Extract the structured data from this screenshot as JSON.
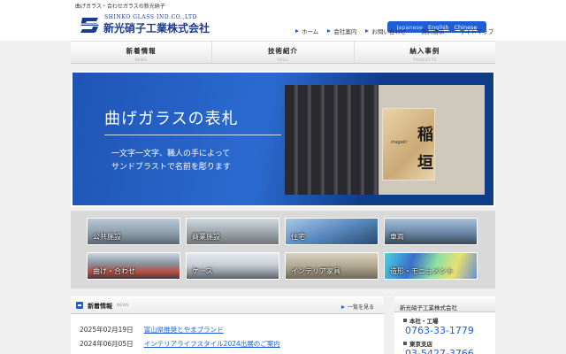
{
  "page": {
    "tagline": "曲げガラス・合わせガラスの新光硝子"
  },
  "header": {
    "logo_en": "SHINKO GLASS IND.CO.,LTD",
    "logo_jp": "新光硝子工業株式会社",
    "languages": [
      "Japanese",
      "English",
      "Chinese"
    ],
    "selected_language": "Japanese",
    "util_nav": [
      "ホーム",
      "会社案内",
      "お問い合わせ",
      "資料請求",
      "サイトマップ"
    ],
    "accent_color": "#1e5fd6"
  },
  "global_nav": [
    {
      "label": "新着情報",
      "sub": "NEWS"
    },
    {
      "label": "技術紹介",
      "sub": "SKILL"
    },
    {
      "label": "納入事例",
      "sub": "PRODUCTS"
    }
  ],
  "hero": {
    "title": "曲げガラスの表札",
    "line1": "一文字一文字、職人の手によって",
    "line2": "サンドブラストで名前を彫ります",
    "plate_char1": "稲",
    "plate_char2": "垣",
    "plate_romaji": "inagaki"
  },
  "categories": [
    {
      "label": "公共施設"
    },
    {
      "label": "商業施設"
    },
    {
      "label": "住宅"
    },
    {
      "label": "車両"
    },
    {
      "label": "曲げ・合わせ"
    },
    {
      "label": "ケース"
    },
    {
      "label": "インテリア家具"
    },
    {
      "label": "造形・モニュメント"
    }
  ],
  "news": {
    "title": "新着情報",
    "title_en": "NEWS",
    "more_label": "一覧を見る",
    "items": [
      {
        "date": "2025年02月19日",
        "title": "富山県推奨とやまブランド"
      },
      {
        "date": "2024年06月05日",
        "title": "インテリアライフスタイル2024出展のご案内"
      }
    ]
  },
  "sidebar": {
    "company": "新光硝子工業株式会社",
    "hq_label": "本社・工場",
    "hq_phone": "0763-33-1779",
    "tokyo_label": "東京支店",
    "tokyo_phone": "03-5427-3766"
  }
}
